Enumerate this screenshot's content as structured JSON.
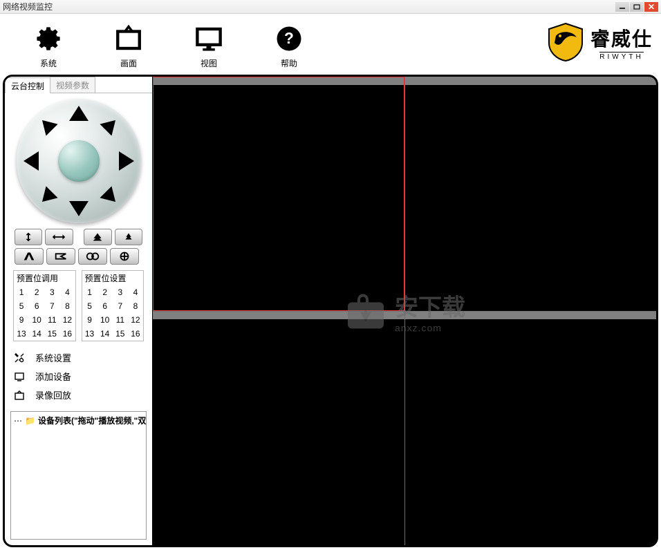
{
  "window": {
    "title": "网络视频监控"
  },
  "toolbar": {
    "system": "系统",
    "screen": "画面",
    "view": "视图",
    "help": "帮助"
  },
  "logo": {
    "cn": "睿威仕",
    "en": "RIWYTH"
  },
  "tabs": {
    "ptz": "云台控制",
    "video_params": "视频参数"
  },
  "presets": {
    "recall_title": "预置位调用",
    "set_title": "预置位设置",
    "nums": [
      "1",
      "2",
      "3",
      "4",
      "5",
      "6",
      "7",
      "8",
      "9",
      "10",
      "11",
      "12",
      "13",
      "14",
      "15",
      "16"
    ]
  },
  "menu": {
    "settings": "系统设置",
    "add_device": "添加设备",
    "playback": "录像回放"
  },
  "tree": {
    "root": "设备列表(\"拖动\"播放视频,\"双"
  },
  "watermark": {
    "cn": "安下载",
    "en": "anxz.com"
  }
}
